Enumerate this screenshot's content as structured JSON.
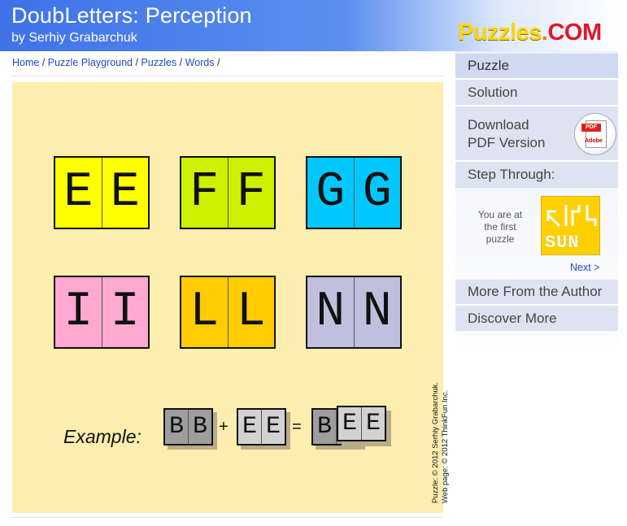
{
  "header": {
    "title": "DoubLetters: Perception",
    "byline": "by Serhiy Grabarchuk",
    "logo_main": "Puzzles",
    "logo_dot": ".",
    "logo_tld": "COM"
  },
  "breadcrumb": {
    "items": [
      "Home",
      "Puzzle Playground",
      "Puzzles",
      "Words"
    ],
    "separator": " / "
  },
  "puzzle": {
    "cards": [
      {
        "letters": [
          "E",
          "E"
        ],
        "color": "#ffff00"
      },
      {
        "letters": [
          "F",
          "F"
        ],
        "color": "#ccf000"
      },
      {
        "letters": [
          "G",
          "G"
        ],
        "color": "#00c8ff"
      },
      {
        "letters": [
          "I",
          "I"
        ],
        "color": "#ffa8d2"
      },
      {
        "letters": [
          "L",
          "L"
        ],
        "color": "#ffcc00"
      },
      {
        "letters": [
          "N",
          "N"
        ],
        "color": "#c0bfdd"
      }
    ],
    "example": {
      "label": "Example:",
      "plus": "+",
      "equals": "=",
      "card1": [
        "B",
        "B"
      ],
      "card2": [
        "E",
        "E"
      ],
      "result_back": "B",
      "result_front": [
        "E",
        "E"
      ],
      "card1_color": "#9e9e9e",
      "card2_color": "#d2d2d2"
    },
    "credit_line1": "Puzzle: © 2012 Serhiy Grabarchuk.",
    "credit_line2": "Web page: © 2012 ThinkFun Inc."
  },
  "sidebar": {
    "puzzle": "Puzzle",
    "solution": "Solution",
    "download_line1": "Download",
    "download_line2": "PDF Version",
    "pdf_tag": "PDF",
    "pdf_brand": "Adobe",
    "step_through": "Step Through:",
    "first_puzzle_text": "You are at the first puzzle",
    "thumb_word": "SUN",
    "next": "Next >",
    "more_from_author": "More From the Author",
    "discover_more": "Discover More"
  }
}
